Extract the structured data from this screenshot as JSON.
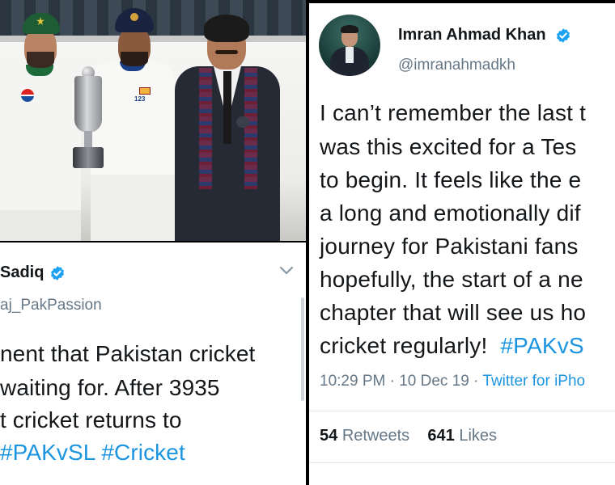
{
  "photo": {
    "alt_subjects": [
      "cricket-player-green-cap",
      "cricket-player-sri-lanka",
      "official-in-suit",
      "test-trophy"
    ],
    "shirt_number": "123",
    "sponsor": "pepsi"
  },
  "left_tweet": {
    "name": "Sadiq",
    "handle": "aj_PakPassion",
    "text_lines": [
      "nent that Pakistan cricket",
      "waiting for. After 3935",
      "t cricket returns to"
    ],
    "hashtags": [
      "#PAKvSL",
      "#Cricket"
    ],
    "colors": {
      "hashtag": "#1b95e0",
      "verified": "#1da1f2"
    }
  },
  "right_tweet": {
    "name": "Imran Ahmad Khan",
    "handle": "@imranahmadkh",
    "text_lines": [
      "I can’t remember the last t",
      "was this excited for a Tes",
      "to begin. It feels like the e",
      "a long and emotionally dif",
      "journey for Pakistani fans",
      "hopefully, the start of a ne",
      "chapter that will see us ho"
    ],
    "last_line_text": "cricket regularly!",
    "last_line_hashtag": "#PAKvS",
    "time": "10:29 PM",
    "date": "10 Dec 19",
    "source": "Twitter for iPho",
    "retweets_count": "54",
    "retweets_label": "Retweets",
    "likes_count": "641",
    "likes_label": "Likes"
  }
}
